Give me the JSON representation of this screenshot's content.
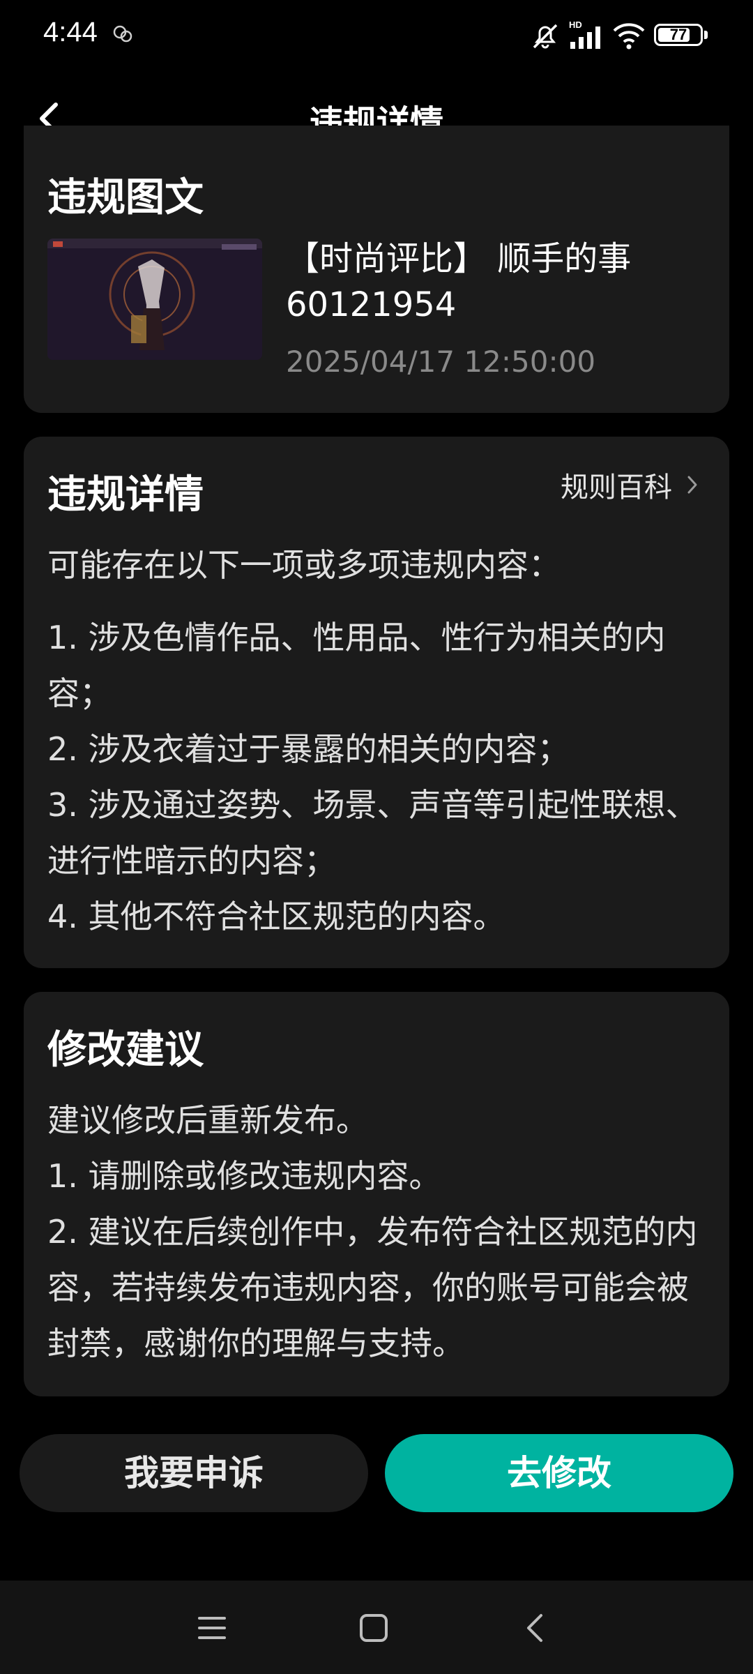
{
  "status_bar": {
    "time": "4:44",
    "left_icon": "notification-badge-icon",
    "icons": [
      "mute-bell-icon",
      "hd-signal-icon",
      "wifi-icon",
      "battery-icon"
    ],
    "hd_label": "HD",
    "battery_level": "77",
    "battery_fraction": 0.77
  },
  "header": {
    "title": "违规详情",
    "back_icon": "chevron-left-icon"
  },
  "violation_post": {
    "section_title": "违规图文",
    "post_title": "【时尚评比】 顺手的事 60121954",
    "post_time": "2025/04/17 12:50:00"
  },
  "violation_details": {
    "section_title": "违规详情",
    "rules_link": "规则百科",
    "intro": "可能存在以下一项或多项违规内容：",
    "items": [
      "1. 涉及色情作品、性用品、性行为相关的内容；",
      "2. 涉及衣着过于暴露的相关的内容；",
      "3. 涉及通过姿势、场景、声音等引起性联想、进行性暗示的内容；",
      "4. 其他不符合社区规范的内容。"
    ]
  },
  "suggestions": {
    "section_title": "修改建议",
    "intro": "建议修改后重新发布。",
    "items": [
      "1. 请删除或修改违规内容。",
      "2. 建议在后续创作中，发布符合社区规范的内容，若持续发布违规内容，你的账号可能会被封禁，感谢你的理解与支持。"
    ]
  },
  "actions": {
    "appeal_label": "我要申诉",
    "modify_label": "去修改",
    "accent_color": "#00b3a0"
  },
  "system_nav": {
    "icons": [
      "menu-icon",
      "home-icon",
      "back-icon"
    ]
  }
}
